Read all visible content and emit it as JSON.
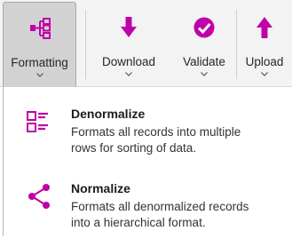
{
  "colors": {
    "accent": "#c000a8",
    "toolbar_bg": "#f3f3f3",
    "active_tool_bg": "#d2d2d2"
  },
  "toolbar": {
    "formatting": {
      "label": "Formatting",
      "icon": "hierarchy-icon"
    },
    "download": {
      "label": "Download",
      "icon": "download-arrow-icon"
    },
    "validate": {
      "label": "Validate",
      "icon": "check-circle-icon"
    },
    "upload": {
      "label": "Upload",
      "icon": "upload-arrow-icon"
    }
  },
  "menu": {
    "items": [
      {
        "title": "Denormalize",
        "description_lines": [
          "Formats all records into multiple",
          "rows for sorting of data."
        ],
        "icon": "denormalize-icon"
      },
      {
        "title": "Normalize",
        "description_lines": [
          "Formats all denormalized records",
          "into a hierarchical format."
        ],
        "icon": "normalize-share-icon"
      }
    ]
  }
}
